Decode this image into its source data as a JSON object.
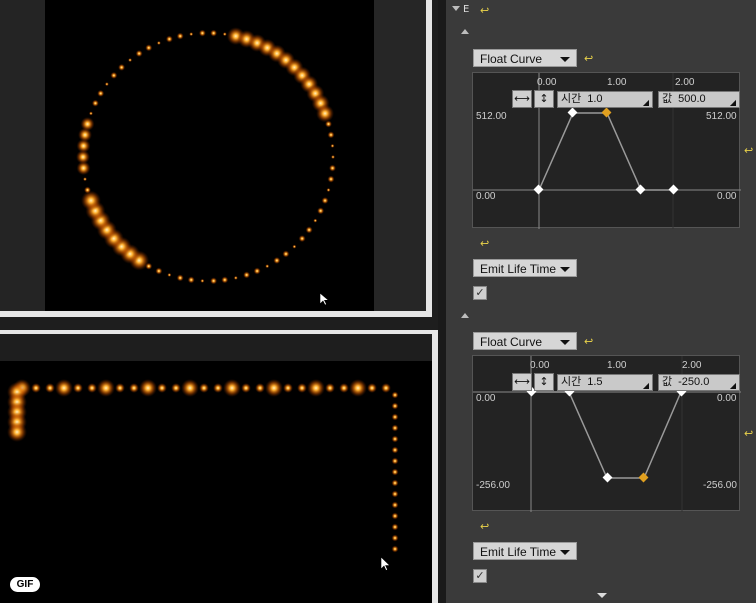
{
  "viewports": {
    "gif_badge": "GIF"
  },
  "details": {
    "curves": [
      {
        "type_dropdown": "Float Curve",
        "axis_top": [
          "0.00",
          "1.00",
          "2.00"
        ],
        "y_max_left": "512.00",
        "y_max_right": "512.00",
        "y_min_left": "0.00",
        "y_min_right": "0.00",
        "fit_h_icon": "⟷",
        "fit_v_icon": "↕",
        "time_label": "시간",
        "time_value": "1.0",
        "value_label": "값",
        "value_value": "500.0",
        "life_dropdown": "Emit Life Time",
        "checkbox": "✓"
      },
      {
        "type_dropdown": "Float Curve",
        "axis_top": [
          "0.00",
          "1.00",
          "2.00"
        ],
        "y_max_left": "0.00",
        "y_max_right": "0.00",
        "y_min_left": "-256.00",
        "y_min_right": "-256.00",
        "fit_h_icon": "⟷",
        "fit_v_icon": "↕",
        "time_label": "시간",
        "time_value": "1.5",
        "value_label": "값",
        "value_value": "-250.0",
        "life_dropdown": "Emit Life Time",
        "checkbox": "✓"
      }
    ]
  },
  "colors": {
    "panel": "#3a3a3a",
    "reset": "#e8d14a",
    "key_selected": "#e0a020",
    "particle": "#ff9a1a"
  }
}
